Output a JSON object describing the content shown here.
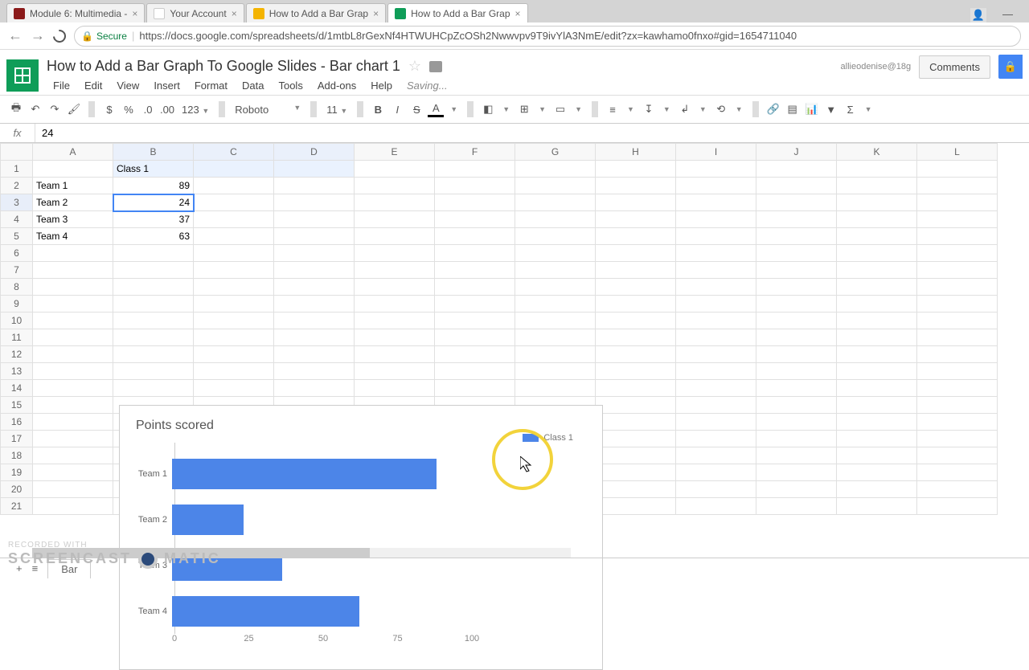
{
  "browser": {
    "tabs": [
      {
        "label": "Module 6: Multimedia -",
        "active": false
      },
      {
        "label": "Your Account",
        "active": false
      },
      {
        "label": "How to Add a Bar Grap",
        "active": false
      },
      {
        "label": "How to Add a Bar Grap",
        "active": true
      }
    ],
    "secure_label": "Secure",
    "url": "https://docs.google.com/spreadsheets/d/1mtbL8rGexNf4HTWUHCpZcOSh2Nwwvpv9T9ivYlA3NmE/edit?zx=kawhamo0fnxo#gid=1654711040"
  },
  "header": {
    "doc_title": "How to Add a Bar Graph To Google Slides - Bar chart 1",
    "email": "allieodenise@18g",
    "comments_btn": "Comments",
    "menus": [
      "File",
      "Edit",
      "View",
      "Insert",
      "Format",
      "Data",
      "Tools",
      "Add-ons",
      "Help"
    ],
    "status": "Saving..."
  },
  "toolbar": {
    "zoom": "123",
    "font": "Roboto",
    "font_size": "11"
  },
  "formula_bar": {
    "label": "fx",
    "value": "24"
  },
  "columns": [
    "A",
    "B",
    "C",
    "D",
    "E",
    "F",
    "G",
    "H",
    "I",
    "J",
    "K",
    "L"
  ],
  "rows": [
    "1",
    "2",
    "3",
    "4",
    "5",
    "6",
    "7",
    "8",
    "9",
    "10",
    "11",
    "12",
    "13",
    "14",
    "15",
    "16",
    "17",
    "18",
    "19",
    "20",
    "21"
  ],
  "cells": {
    "B1": "Class 1",
    "A2": "Team 1",
    "B2": "89",
    "A3": "Team 2",
    "B3": "24",
    "A4": "Team 3",
    "B4": "37",
    "A5": "Team 4",
    "B5": "63"
  },
  "active_cell": "B3",
  "chart_data": {
    "type": "bar",
    "title": "Points scored",
    "categories": [
      "Team 1",
      "Team 2",
      "Team 3",
      "Team 4"
    ],
    "series": [
      {
        "name": "Class 1",
        "values": [
          89,
          24,
          37,
          63
        ]
      }
    ],
    "xlim": [
      0,
      100
    ],
    "xticks": [
      0,
      25,
      50,
      75,
      100
    ],
    "legend_position": "right"
  },
  "sheet_tabs": {
    "active": "Bar"
  },
  "watermark": {
    "line1": "RECORDED WITH",
    "line2a": "SCREENCAST",
    "line2b": "MATIC"
  }
}
